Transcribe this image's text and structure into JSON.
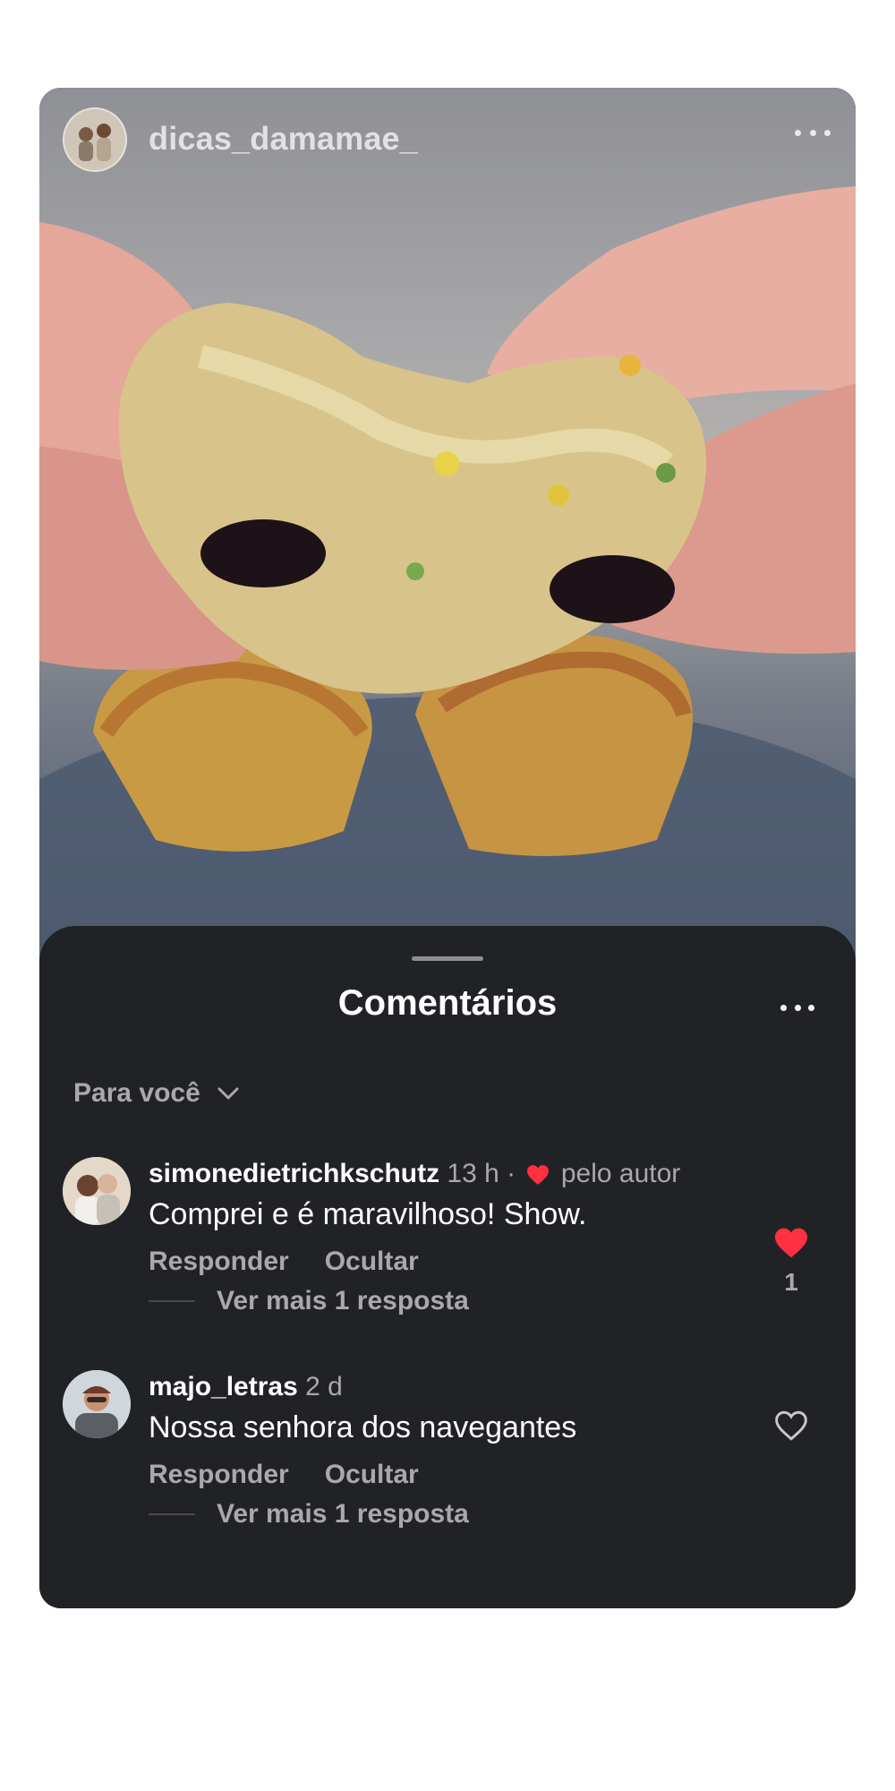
{
  "post": {
    "username": "dicas_damamae_"
  },
  "comments_sheet": {
    "title": "Comentários",
    "filter_label": "Para você"
  },
  "comments": [
    {
      "username": "simonedietrichkschutz",
      "time": "13 h",
      "separator": "·",
      "liked_by_author_text": "pelo autor",
      "text": "Comprei e é maravilhoso! Show.",
      "reply_label": "Responder",
      "hide_label": "Ocultar",
      "view_replies": "Ver mais 1 resposta",
      "like_count": "1",
      "liked": true
    },
    {
      "username": "majo_letras",
      "time": "2 d",
      "text": "Nossa senhora dos navegantes",
      "reply_label": "Responder",
      "hide_label": "Ocultar",
      "view_replies": "Ver mais 1 resposta",
      "liked": false
    }
  ],
  "colors": {
    "sheet_bg": "#212226",
    "like_red": "#ff3040",
    "muted_text": "#a8a8ad"
  }
}
